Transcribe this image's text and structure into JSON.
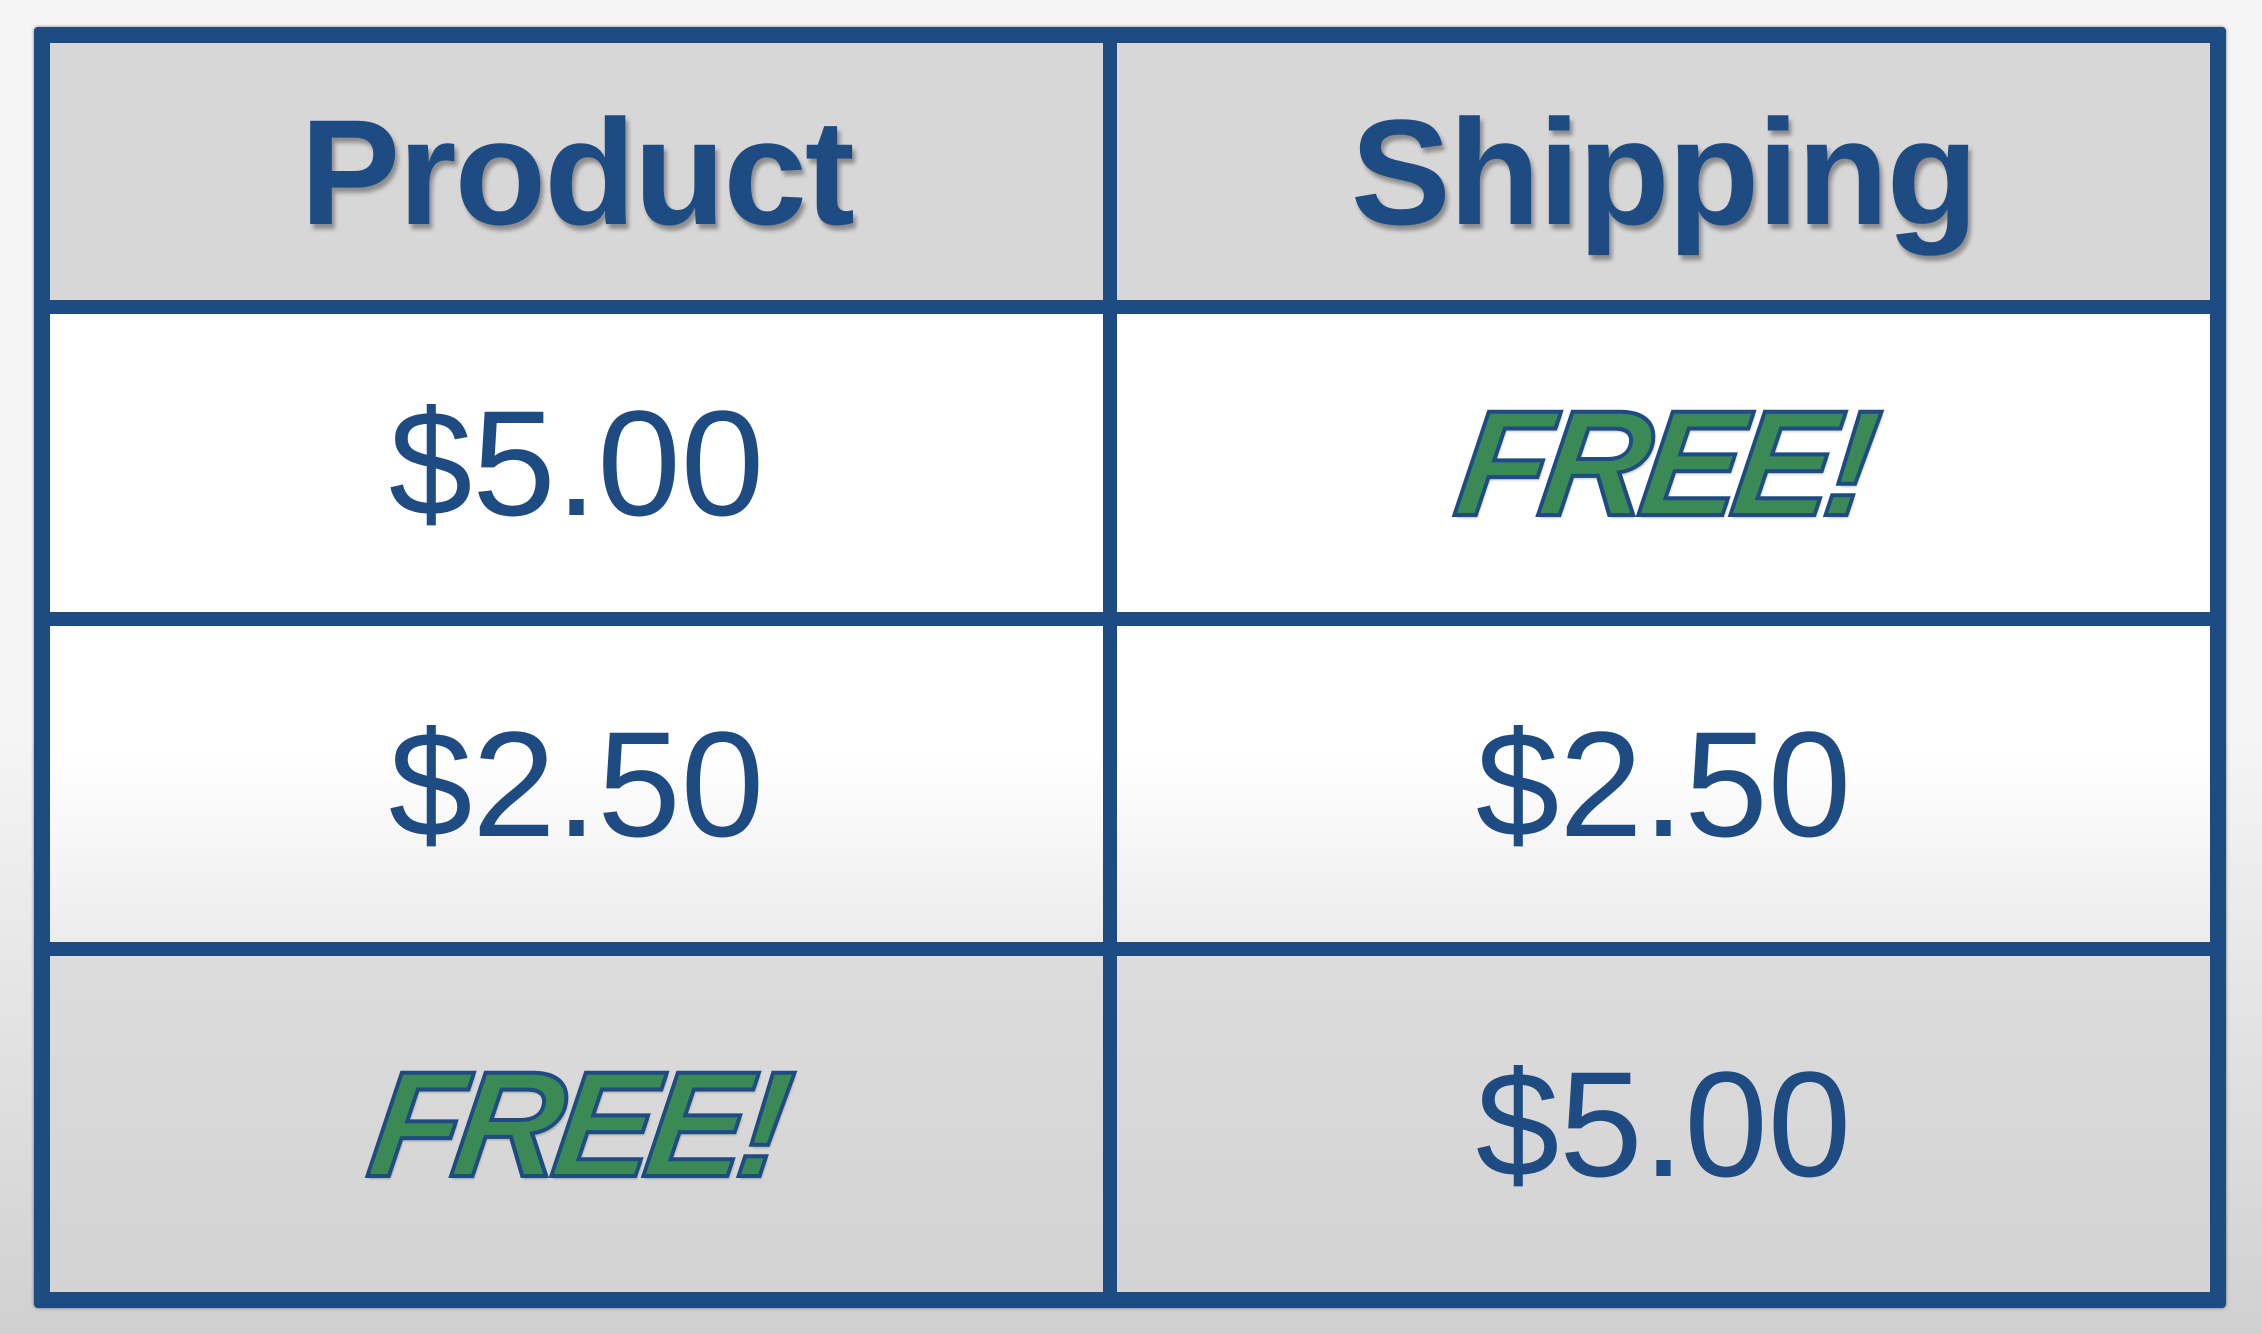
{
  "table": {
    "headers": [
      "Product",
      "Shipping"
    ],
    "rows": [
      [
        "$5.00",
        "FREE!"
      ],
      [
        "$2.50",
        "$2.50"
      ],
      [
        "FREE!",
        "$5.00"
      ]
    ]
  },
  "colors": {
    "border": "#1f4b83",
    "text": "#1f4b83",
    "free_fill": "#3b8a55",
    "header_bg": "#d7d7d7"
  }
}
